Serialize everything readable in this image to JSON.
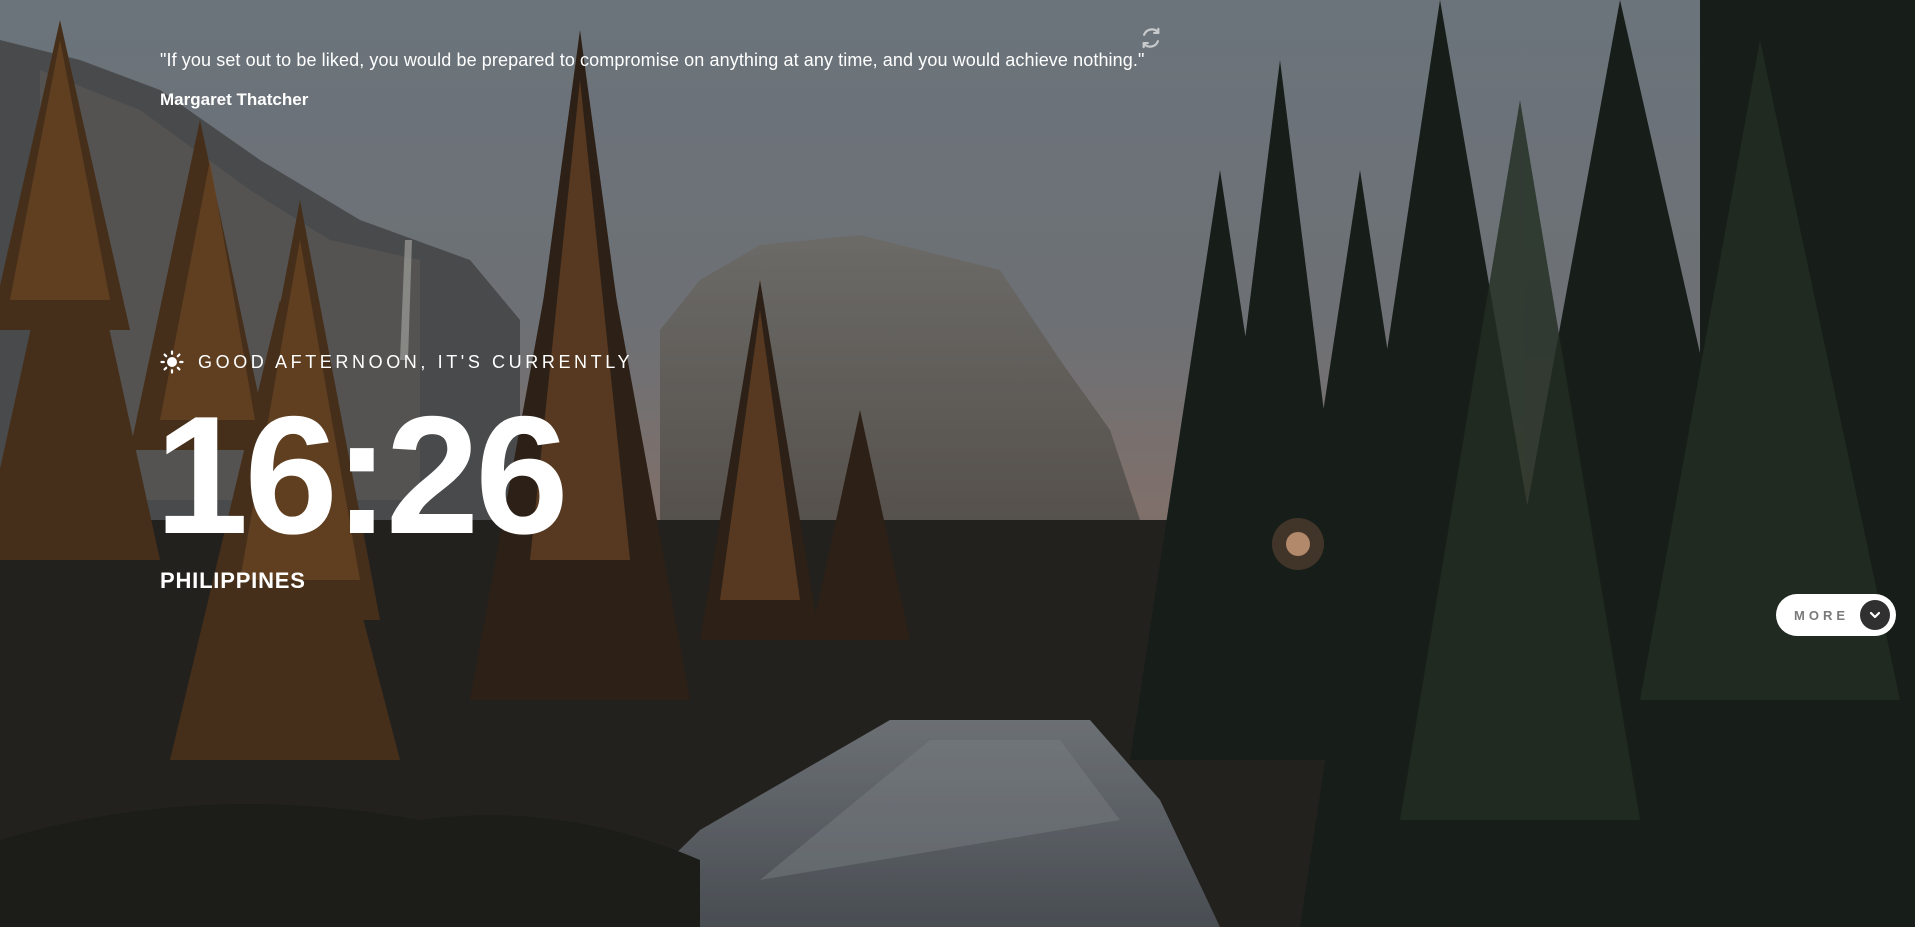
{
  "quote": {
    "text": "\"If you set out to be liked, you would be prepared to compromise on anything at any time, and you would achieve nothing.\"",
    "author": "Margaret Thatcher"
  },
  "clock": {
    "greeting": "GOOD AFTERNOON, IT'S CURRENTLY",
    "time": "16:26",
    "location": "PHILIPPINES"
  },
  "controls": {
    "more_label": "MORE"
  },
  "icons": {
    "refresh": "refresh-icon",
    "sun": "sun-icon",
    "chevron": "chevron-down-icon"
  },
  "colors": {
    "text": "#ffffff",
    "button_bg": "#ffffff",
    "button_text": "#7a7a7a",
    "button_arrow_bg": "#303030"
  }
}
